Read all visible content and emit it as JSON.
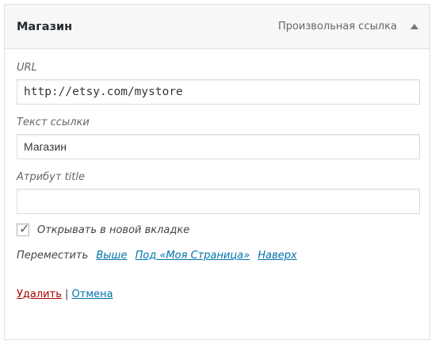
{
  "header": {
    "title": "Магазин",
    "type_label": "Произвольная ссылка"
  },
  "fields": {
    "url": {
      "label": "URL",
      "value": "http://etsy.com/mystore"
    },
    "link_text": {
      "label": "Текст ссылки",
      "value": "Магазин"
    },
    "title_attr": {
      "label": "Атрибут title",
      "value": ""
    }
  },
  "new_tab": {
    "label": "Открывать в новой вкладке",
    "checked": true
  },
  "move": {
    "label": "Переместить",
    "up": "Выше",
    "under": "Под «Моя Страница»",
    "top": "Наверх"
  },
  "actions": {
    "delete": "Удалить",
    "separator": "|",
    "cancel": "Отмена"
  }
}
